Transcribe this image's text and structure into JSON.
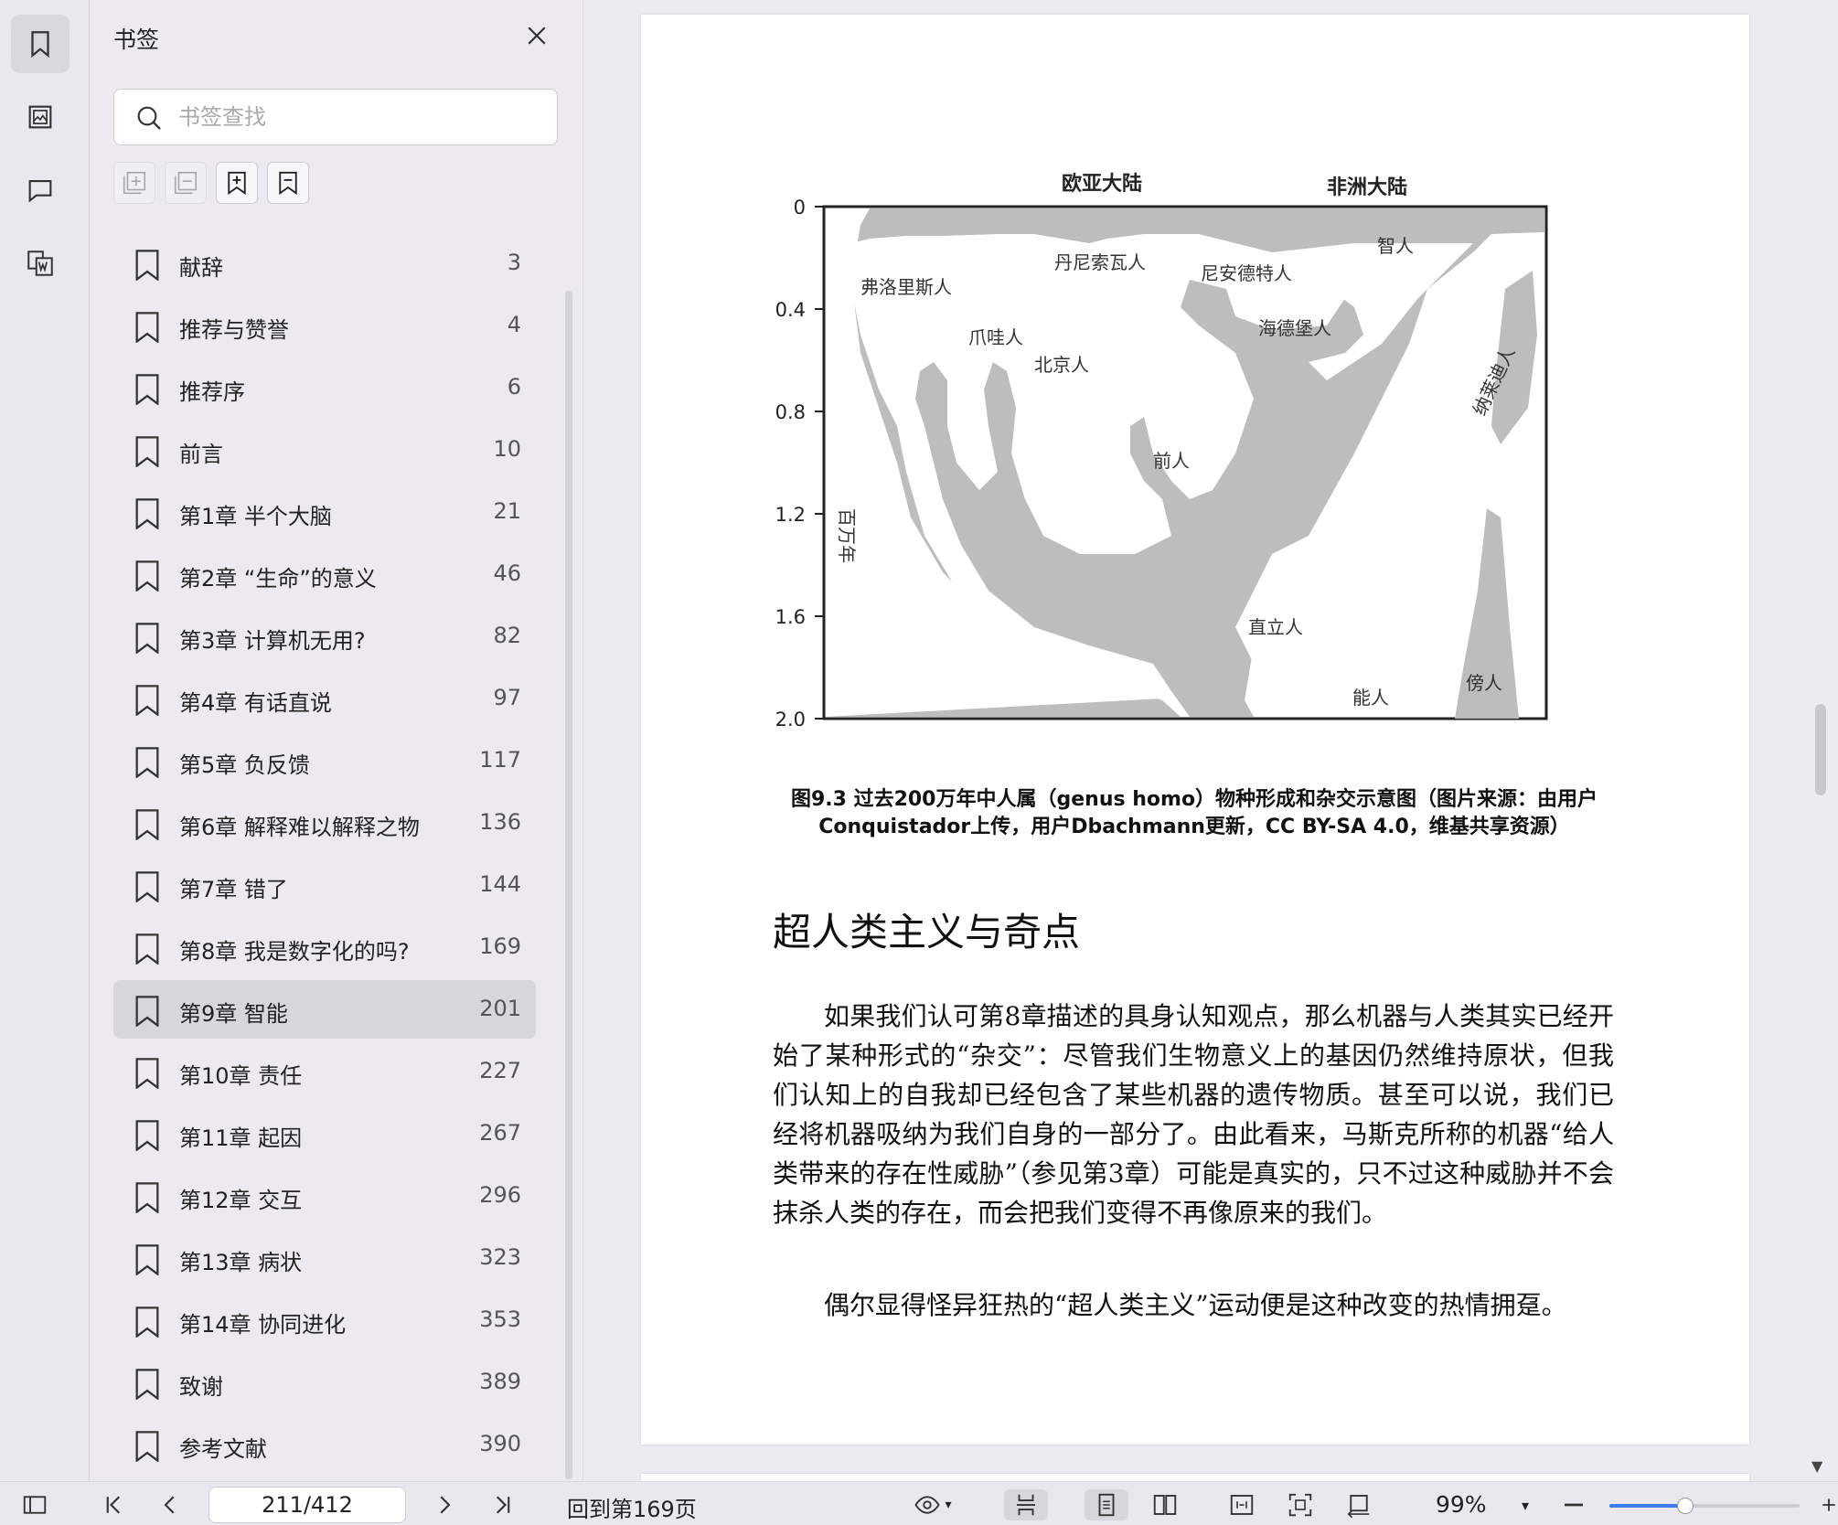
{
  "sidebar_panel": {
    "title": "书签",
    "search_placeholder": "书签查找",
    "bookmarks": [
      {
        "label": "献辞",
        "page": "3"
      },
      {
        "label": "推荐与赞誉",
        "page": "4"
      },
      {
        "label": "推荐序",
        "page": "6"
      },
      {
        "label": "前言",
        "page": "10"
      },
      {
        "label": "第1章 半个大脑",
        "page": "21"
      },
      {
        "label": "第2章 “生命”的意义",
        "page": "46"
      },
      {
        "label": "第3章 计算机无用?",
        "page": "82"
      },
      {
        "label": "第4章 有话直说",
        "page": "97"
      },
      {
        "label": "第5章 负反馈",
        "page": "117"
      },
      {
        "label": "第6章 解释难以解释之物",
        "page": "136"
      },
      {
        "label": "第7章 错了",
        "page": "144"
      },
      {
        "label": "第8章 我是数字化的吗?",
        "page": "169"
      },
      {
        "label": "第9章 智能",
        "page": "201"
      },
      {
        "label": "第10章 责任",
        "page": "227"
      },
      {
        "label": "第11章 起因",
        "page": "267"
      },
      {
        "label": "第12章 交互",
        "page": "296"
      },
      {
        "label": "第13章 病状",
        "page": "323"
      },
      {
        "label": "第14章 协同进化",
        "page": "353"
      },
      {
        "label": "致谢",
        "page": "389"
      },
      {
        "label": "参考文献",
        "page": "390"
      }
    ],
    "selected_index": 12
  },
  "document": {
    "figure": {
      "column_labels": [
        "欧亚大陆",
        "非洲大陆"
      ],
      "y_ticks": [
        "0",
        "0.4",
        "0.8",
        "1.2",
        "1.6",
        "2.0"
      ],
      "y_axis_label": "百万年",
      "species": {
        "florisiensis": "弗洛里斯人",
        "denisova": "丹尼索瓦人",
        "neanderthal": "尼安德特人",
        "sapiens": "智人",
        "java": "爪哇人",
        "peking": "北京人",
        "heidelberg": "海德堡人",
        "naledi": "纳莱迪人",
        "antecessor": "前人",
        "erectus": "直立人",
        "habilis": "能人",
        "paranthropus": "傍人"
      }
    },
    "caption_line1": "图9.3 过去200万年中人属（genus homo）物种形成和杂交示意图（图片来源：由用户",
    "caption_line2": "Conquistador上传，用户Dbachmann更新，CC BY-SA 4.0，维基共享资源）",
    "section_title": "超人类主义与奇点",
    "paragraph1": "如果我们认可第8章描述的具身认知观点，那么机器与人类其实已经开始了某种形式的“杂交”：尽管我们生物意义上的基因仍然维持原状，但我们认知上的自我却已经包含了某些机器的遗传物质。甚至可以说，我们已经将机器吸纳为我们自身的一部分了。由此看来，马斯克所称的机器“给人类带来的存在性威胁”（参见第3章）可能是真实的，只不过这种威胁并不会抹杀人类的存在，而会把我们变得不再像原来的我们。",
    "paragraph2": "偶尔显得怪异狂热的“超人类主义”运动便是这种改变的热情拥趸。"
  },
  "toolbar": {
    "page_indicator": "211/412",
    "goto_label": "回到第169页",
    "zoom_label": "99%",
    "zoom_fraction": 0.4
  },
  "colors": {
    "accent": "#3b7bf0",
    "figure_fill": "#bdbdbd",
    "selected_row": "#d7d6dc"
  }
}
